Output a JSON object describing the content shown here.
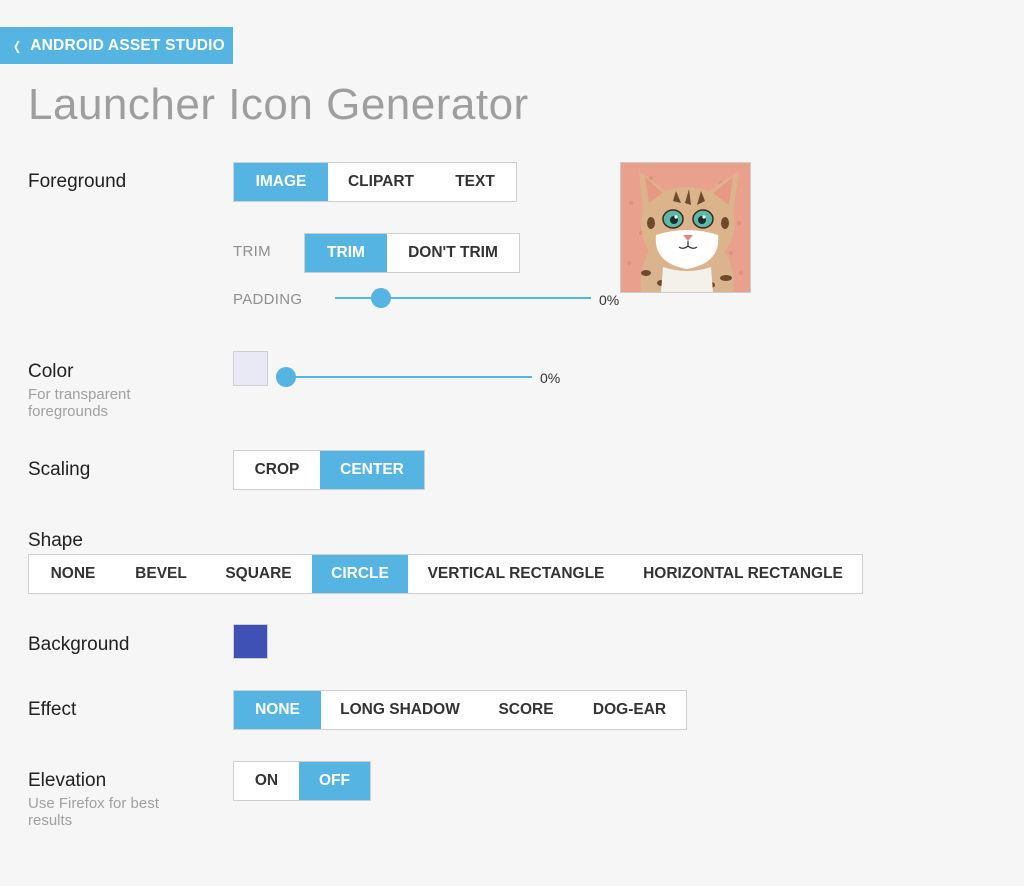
{
  "header": {
    "back_label": "ANDROID ASSET STUDIO",
    "title": "Launcher Icon Generator"
  },
  "foreground": {
    "label": "Foreground",
    "sources": [
      "IMAGE",
      "CLIPART",
      "TEXT"
    ],
    "selected_source": "IMAGE",
    "trim_label": "TRIM",
    "trim_options": [
      "TRIM",
      "DON'T TRIM"
    ],
    "selected_trim": "TRIM",
    "padding_label": "PADDING",
    "padding_value": "0%",
    "padding_fraction": 0.18,
    "preview_icon": "cat-image-preview"
  },
  "color": {
    "label": "Color",
    "sublabel_line1": "For transparent",
    "sublabel_line2": "foregrounds",
    "swatch_color": "#e8e9f4",
    "value": "0%",
    "slider_fraction": 0.0
  },
  "scaling": {
    "label": "Scaling",
    "options": [
      "CROP",
      "CENTER"
    ],
    "selected": "CENTER"
  },
  "shape": {
    "label": "Shape",
    "options": [
      "NONE",
      "BEVEL",
      "SQUARE",
      "CIRCLE",
      "VERTICAL RECTANGLE",
      "HORIZONTAL RECTANGLE"
    ],
    "selected": "CIRCLE"
  },
  "background": {
    "label": "Background",
    "swatch_color": "#3f51b5"
  },
  "effect": {
    "label": "Effect",
    "options": [
      "NONE",
      "LONG SHADOW",
      "SCORE",
      "DOG-EAR"
    ],
    "selected": "NONE"
  },
  "elevation": {
    "label": "Elevation",
    "sublabel_line1": "Use Firefox for best",
    "sublabel_line2": "results",
    "options": [
      "ON",
      "OFF"
    ],
    "selected": "OFF"
  },
  "colors": {
    "accent": "#56b4e3",
    "title": "#9e9e9e",
    "muted": "#a0a0a0"
  }
}
